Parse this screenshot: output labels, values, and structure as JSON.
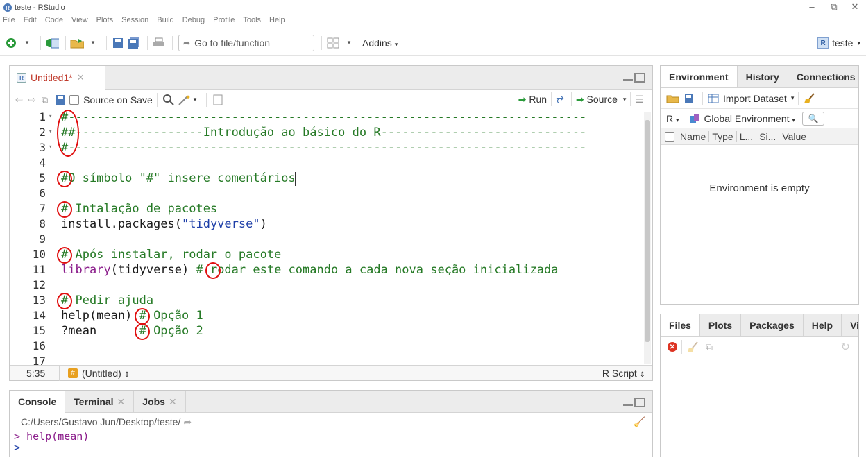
{
  "window": {
    "title": "teste - RStudio",
    "app_icon_letter": "R",
    "minimize": "–",
    "maximize": "⧉",
    "close": "✕"
  },
  "menu": [
    "File",
    "Edit",
    "Code",
    "View",
    "Plots",
    "Session",
    "Build",
    "Debug",
    "Profile",
    "Tools",
    "Help"
  ],
  "toolbar": {
    "goto_placeholder": "Go to file/function",
    "addins_label": "Addins",
    "project_label": "teste"
  },
  "editor": {
    "tab_label": "Untitled1*",
    "source_on_save": "Source on Save",
    "run_label": "Run",
    "source_label": "Source",
    "status_position": "5:35",
    "status_scope": "(Untitled)",
    "status_filetype": "R Script",
    "lines": [
      {
        "n": "1",
        "parts": [
          {
            "c": "cmt",
            "t": "#-------------------------------------------------------------------------"
          }
        ]
      },
      {
        "n": "2",
        "parts": [
          {
            "c": "cmt",
            "t": "##------------------Introdução ao básico do R-----------------------------"
          }
        ]
      },
      {
        "n": "3",
        "parts": [
          {
            "c": "cmt",
            "t": "#-------------------------------------------------------------------------"
          }
        ]
      },
      {
        "n": "4",
        "parts": []
      },
      {
        "n": "5",
        "parts": [
          {
            "c": "cmt",
            "t": "#O símbolo \"#\" insere comentários"
          }
        ]
      },
      {
        "n": "6",
        "parts": []
      },
      {
        "n": "7",
        "parts": [
          {
            "c": "cmt",
            "t": "# Intalação de pacotes"
          }
        ]
      },
      {
        "n": "8",
        "parts": [
          {
            "c": "plain",
            "t": "install.packages("
          },
          {
            "c": "str",
            "t": "\"tidyverse\""
          },
          {
            "c": "plain",
            "t": ")"
          }
        ]
      },
      {
        "n": "9",
        "parts": []
      },
      {
        "n": "10",
        "parts": [
          {
            "c": "cmt",
            "t": "# Após instalar, rodar o pacote"
          }
        ]
      },
      {
        "n": "11",
        "parts": [
          {
            "c": "kw",
            "t": "library"
          },
          {
            "c": "plain",
            "t": "(tidyverse) "
          },
          {
            "c": "cmt",
            "t": "# rodar este comando a cada nova seção inicializada"
          }
        ]
      },
      {
        "n": "12",
        "parts": []
      },
      {
        "n": "13",
        "parts": [
          {
            "c": "cmt",
            "t": "# Pedir ajuda"
          }
        ]
      },
      {
        "n": "14",
        "parts": [
          {
            "c": "plain",
            "t": "help(mean) "
          },
          {
            "c": "cmt",
            "t": "# Opção 1"
          }
        ]
      },
      {
        "n": "15",
        "parts": [
          {
            "c": "plain",
            "t": "?mean      "
          },
          {
            "c": "cmt",
            "t": "# Opção 2"
          }
        ]
      },
      {
        "n": "16",
        "parts": []
      },
      {
        "n": "17",
        "parts": []
      }
    ]
  },
  "console": {
    "tabs": [
      {
        "label": "Console",
        "closable": false
      },
      {
        "label": "Terminal",
        "closable": true
      },
      {
        "label": "Jobs",
        "closable": true
      }
    ],
    "path": "C:/Users/Gustavo Jun/Desktop/teste/",
    "echo_line": "> help(mean)",
    "prompt": ">"
  },
  "environment": {
    "tabs": [
      "Environment",
      "History",
      "Connections"
    ],
    "import_label": "Import Dataset",
    "r_label": "R",
    "global_env_label": "Global Environment",
    "columns": [
      "Name",
      "Type",
      "L...",
      "Si...",
      "Value"
    ],
    "empty_message": "Environment is empty"
  },
  "files": {
    "tabs": [
      "Files",
      "Plots",
      "Packages",
      "Help",
      "Viewer"
    ]
  },
  "colors": {
    "comment": "#267a26",
    "string": "#1e3fa8",
    "marker": "#e01010"
  }
}
